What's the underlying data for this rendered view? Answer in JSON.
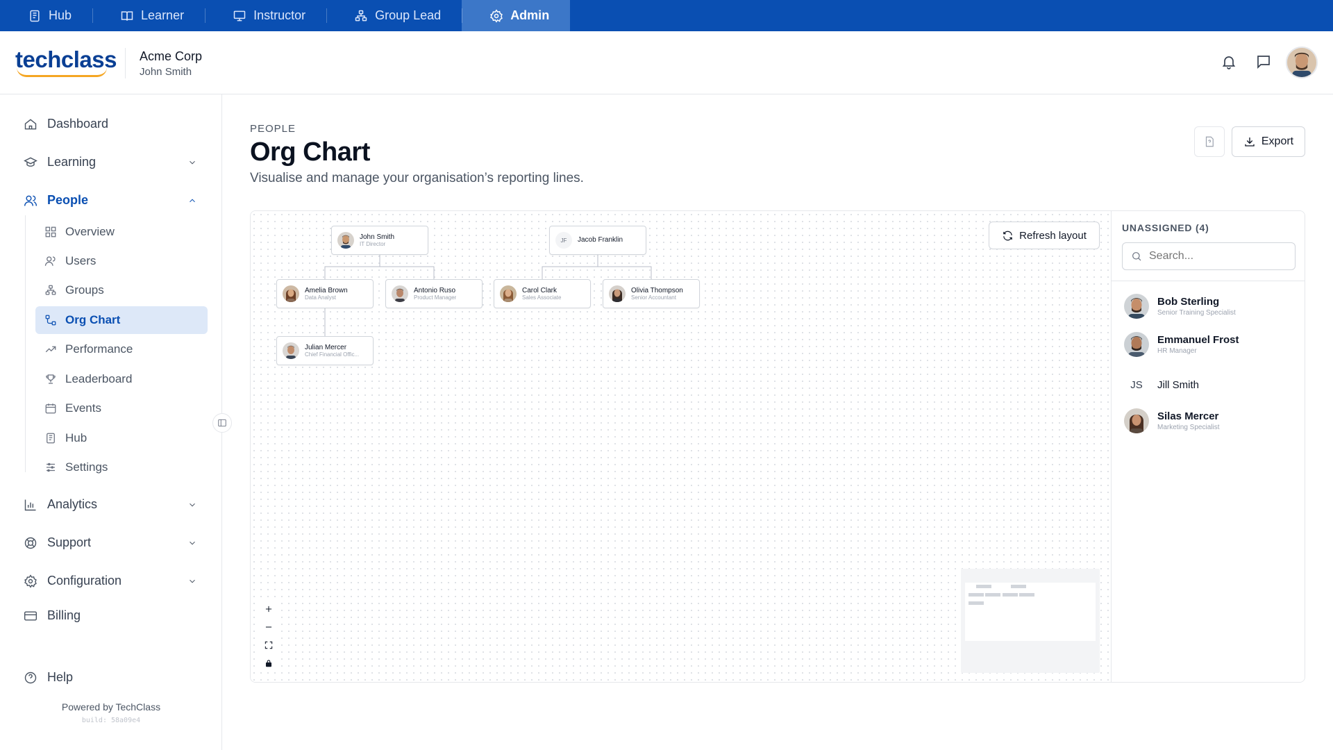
{
  "roles": [
    {
      "label": "Hub",
      "icon": "hub-icon",
      "active": false
    },
    {
      "label": "Learner",
      "icon": "book-icon",
      "active": false
    },
    {
      "label": "Instructor",
      "icon": "presentation-icon",
      "active": false
    },
    {
      "label": "Group Lead",
      "icon": "group-icon",
      "active": false
    },
    {
      "label": "Admin",
      "icon": "gear-icon",
      "active": true
    }
  ],
  "brand": {
    "name": "techclass",
    "accent": "#0a3f94",
    "arc": "#f5a623"
  },
  "org": {
    "name": "Acme Corp",
    "user": "John Smith"
  },
  "sidebar": {
    "items": [
      {
        "label": "Dashboard"
      },
      {
        "label": "Learning"
      },
      {
        "label": "People"
      },
      {
        "label": "Analytics"
      },
      {
        "label": "Support"
      },
      {
        "label": "Configuration"
      },
      {
        "label": "Billing"
      },
      {
        "label": "Help"
      }
    ],
    "people_sub": [
      {
        "label": "Overview"
      },
      {
        "label": "Users"
      },
      {
        "label": "Groups"
      },
      {
        "label": "Org Chart",
        "active": true
      },
      {
        "label": "Performance"
      },
      {
        "label": "Leaderboard"
      },
      {
        "label": "Events"
      },
      {
        "label": "Hub"
      },
      {
        "label": "Settings"
      }
    ],
    "powered_by": "Powered by TechClass",
    "build": "build: 58a09e4"
  },
  "page": {
    "eyebrow": "PEOPLE",
    "title": "Org Chart",
    "subtitle": "Visualise and manage your organisation’s reporting lines.",
    "export_label": "Export"
  },
  "chart": {
    "refresh_label": "Refresh layout",
    "nodes": [
      {
        "name": "John Smith",
        "role": "IT Director",
        "avatar": "photo"
      },
      {
        "name": "Jacob Franklin",
        "role": "",
        "initials": "JF"
      },
      {
        "name": "Amelia Brown",
        "role": "Data Analyst",
        "avatar": "photo"
      },
      {
        "name": "Antonio Ruso",
        "role": "Product Manager",
        "avatar": "photo"
      },
      {
        "name": "Carol Clark",
        "role": "Sales Associate",
        "avatar": "photo"
      },
      {
        "name": "Olivia Thompson",
        "role": "Senior Accountant",
        "avatar": "photo"
      },
      {
        "name": "Julian Mercer",
        "role": "Chief Financial Offic...",
        "avatar": "photo"
      }
    ],
    "reporting_lines": [
      {
        "manager": "John Smith",
        "report": "Amelia Brown"
      },
      {
        "manager": "John Smith",
        "report": "Antonio Ruso"
      },
      {
        "manager": "Jacob Franklin",
        "report": "Carol Clark"
      },
      {
        "manager": "Jacob Franklin",
        "report": "Olivia Thompson"
      },
      {
        "manager": "Amelia Brown",
        "report": "Julian Mercer"
      }
    ]
  },
  "unassigned": {
    "title": "UNASSIGNED (4)",
    "search_placeholder": "Search...",
    "people": [
      {
        "name": "Bob Sterling",
        "role": "Senior Training Specialist",
        "avatar": "photo"
      },
      {
        "name": "Emmanuel Frost",
        "role": "HR Manager",
        "avatar": "photo"
      },
      {
        "name": "Jill Smith",
        "role": "",
        "initials": "JS"
      },
      {
        "name": "Silas Mercer",
        "role": "Marketing Specialist",
        "avatar": "photo"
      }
    ]
  },
  "colors": {
    "topbar": "#0a4fb2",
    "active_role": "#3c77c8",
    "active_nav": "#0a4fb2",
    "active_nav_bg": "#dde8f8"
  }
}
